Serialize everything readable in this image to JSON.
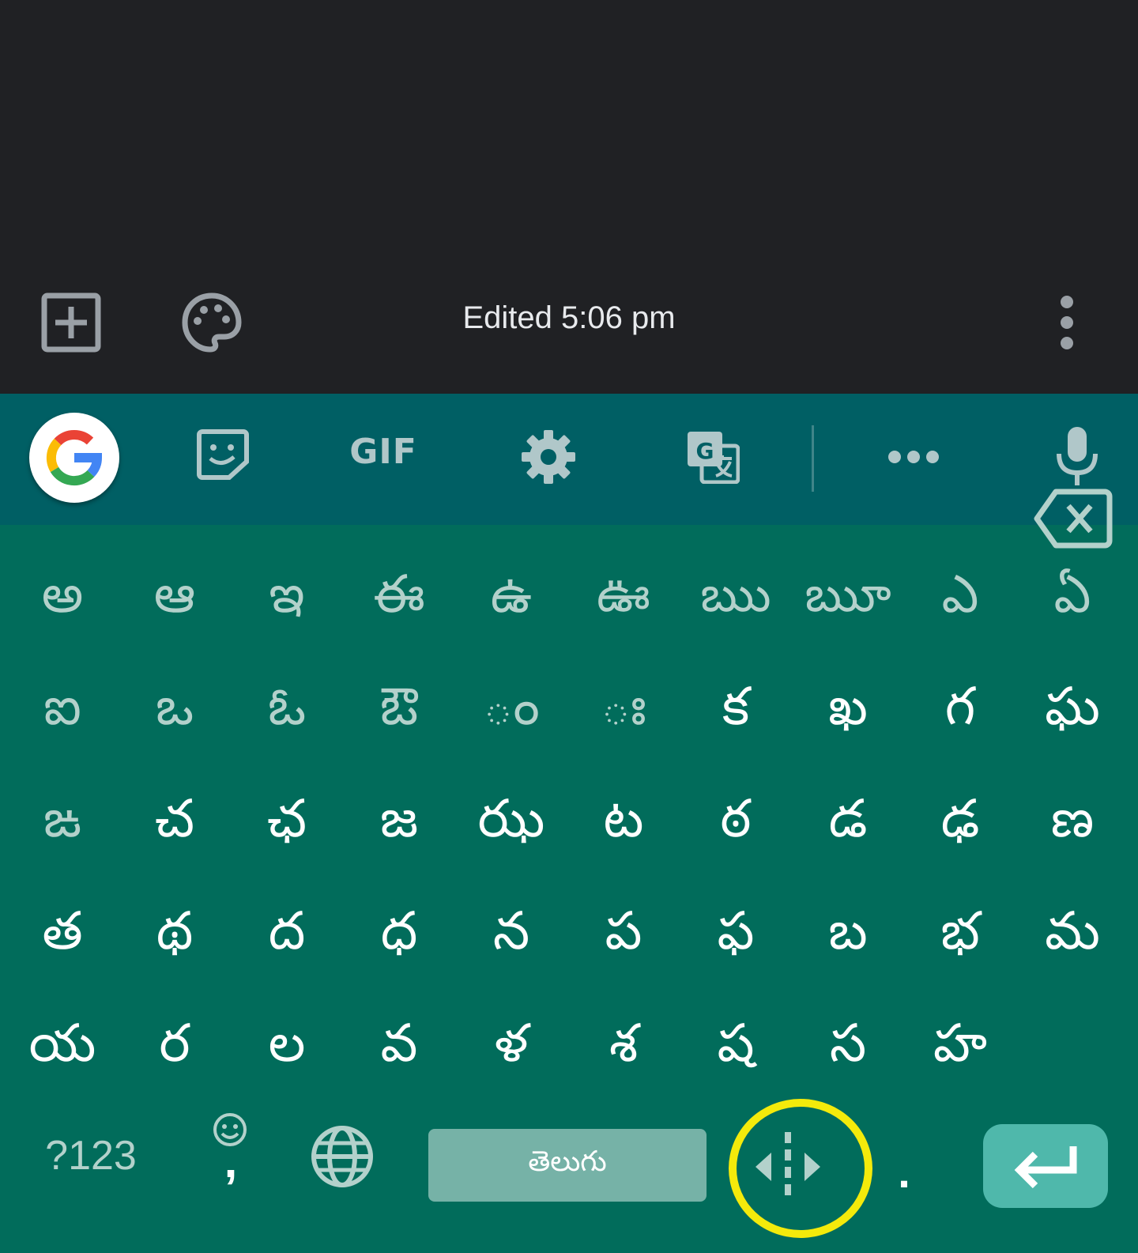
{
  "note": {
    "edited_text": "Edited 5:06 pm"
  },
  "toolbar": {
    "gif_label": "GIF"
  },
  "keyboard": {
    "rows": [
      [
        "అ",
        "ఆ",
        "ఇ",
        "ఈ",
        "ఉ",
        "ఊ",
        "ఋ",
        "ౠ",
        "ఎ",
        "ఏ"
      ],
      [
        "ఐ",
        "ఒ",
        "ఓ",
        "ఔ",
        "◌ం",
        "◌ః",
        "క",
        "ఖ",
        "గ",
        "ఘ"
      ],
      [
        "ఙ",
        "చ",
        "ఛ",
        "జ",
        "ఝ",
        "ట",
        "ఠ",
        "డ",
        "ఢ",
        "ణ"
      ],
      [
        "త",
        "థ",
        "ద",
        "ధ",
        "న",
        "ప",
        "ఫ",
        "బ",
        "భ",
        "మ"
      ],
      [
        "య",
        "ర",
        "ల",
        "వ",
        "ళ",
        "శ",
        "ష",
        "స",
        "హ"
      ]
    ],
    "symbols_label": "?123",
    "comma_label": ",",
    "space_label": "తెలుగు",
    "period_label": "."
  },
  "colors": {
    "note_bg": "#202124",
    "toolbar_bg": "#005f64",
    "keyboard_bg": "#016c5b",
    "highlight": "#f4ea0b",
    "enter_bg": "#4fb8ab"
  }
}
